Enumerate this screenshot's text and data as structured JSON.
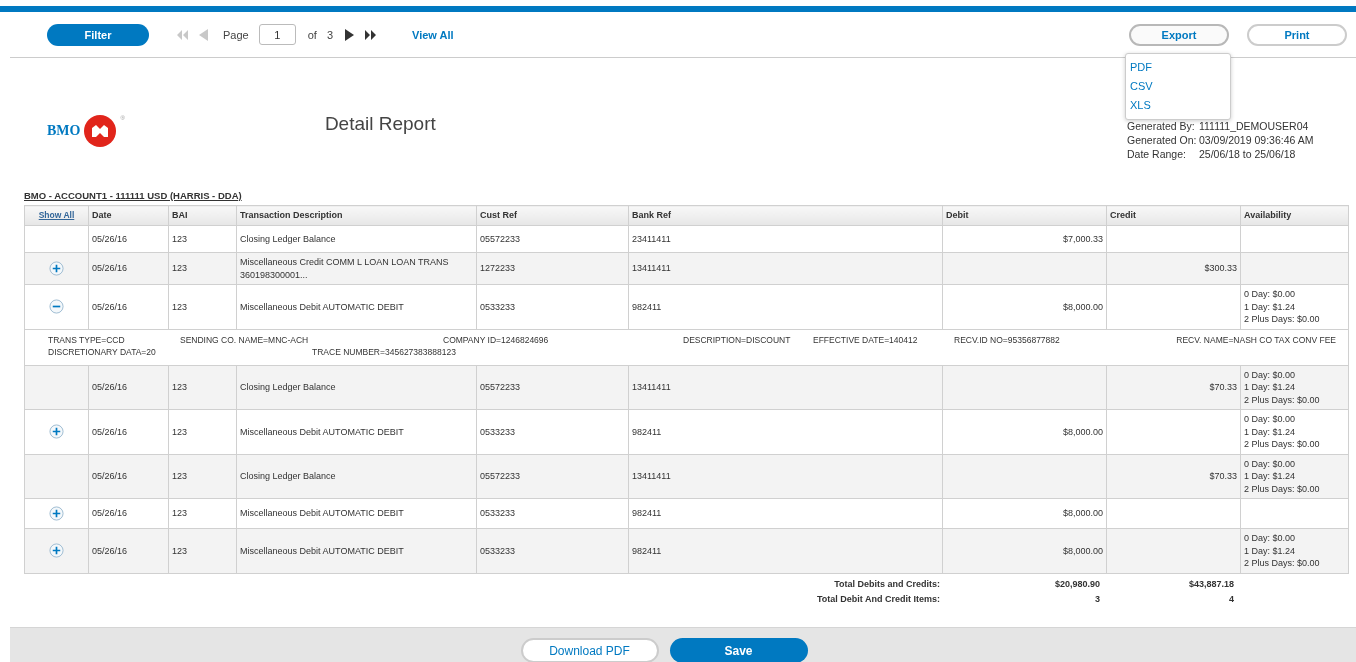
{
  "toolbar": {
    "filter": "Filter",
    "pager": {
      "first_disabled": true,
      "prev_disabled": true,
      "next_disabled": false,
      "last_disabled": false,
      "page_label": "Page",
      "page": "1",
      "of_label": "of",
      "total": "3"
    },
    "view_all": "View All",
    "export": {
      "label": "Export",
      "open": true,
      "options": [
        "PDF",
        "CSV",
        "XLS"
      ]
    },
    "print": "Print"
  },
  "header": {
    "logo_text": "BMO",
    "logo_mark": "®",
    "title": "Detail Report",
    "meta": [
      {
        "label": "Generated By:",
        "value": "111111_DEMOUSER04"
      },
      {
        "label": "Generated On:",
        "value": "03/09/2019 09:36:46 AM"
      },
      {
        "label": "Date Range:",
        "value": "25/06/18 to 25/06/18"
      }
    ]
  },
  "account": "BMO - ACCOUNT1 - 111111 USD (HARRIS - DDA)",
  "table": {
    "show_all": "Show All",
    "columns": [
      "Date",
      "BAI",
      "Transaction Description",
      "Cust Ref",
      "Bank Ref",
      "Debit",
      "Credit",
      "Availability"
    ],
    "rows": [
      {
        "date": "05/26/16",
        "bai": "123",
        "description": "Closing Ledger Balance",
        "cust_ref": "05572233",
        "bank_ref": "23411411",
        "debit": "$7,000.33",
        "credit": "",
        "availability": []
      },
      {
        "expanded": false,
        "date": "05/26/16",
        "bai": "123",
        "description": "Miscellaneous Credit COMM L LOAN LOAN TRANS 360198300001...",
        "cust_ref": "1272233",
        "bank_ref": "13411411",
        "debit": "",
        "credit": "$300.33",
        "availability": []
      },
      {
        "expanded": true,
        "date": "05/26/16",
        "bai": "123",
        "description": "Miscellaneous Debit AUTOMATIC DEBIT",
        "cust_ref": "0533233",
        "bank_ref": "982411",
        "debit": "$8,000.00",
        "credit": "",
        "availability": [
          "0 Day: $0.00",
          "1 Day: $1.24",
          "2 Plus Days: $0.00"
        ],
        "details": [
          [
            "TRANS TYPE=CCD",
            "SENDING CO. NAME=MNC-ACH",
            "COMPANY ID=1246824696",
            "DESCRIPTION=DISCOUNT",
            "EFFECTIVE DATE=140412",
            "RECV.ID NO=95356877882",
            "RECV. NAME=NASH CO TAX CONV FEE"
          ],
          [
            "DISCRETIONARY DATA=20",
            "TRACE NUMBER=345627383888123"
          ]
        ]
      },
      {
        "date": "05/26/16",
        "bai": "123",
        "description": "Closing Ledger Balance",
        "cust_ref": "05572233",
        "bank_ref": "13411411",
        "debit": "",
        "credit": "$70.33",
        "availability": [
          "0 Day: $0.00",
          "1 Day: $1.24",
          "2 Plus Days: $0.00"
        ]
      },
      {
        "expanded": false,
        "date": "05/26/16",
        "bai": "123",
        "description": "Miscellaneous Debit AUTOMATIC DEBIT",
        "cust_ref": "0533233",
        "bank_ref": "982411",
        "debit": "$8,000.00",
        "credit": "",
        "availability": [
          "0 Day: $0.00",
          "1 Day: $1.24",
          "2 Plus Days: $0.00"
        ]
      },
      {
        "date": "05/26/16",
        "bai": "123",
        "description": "Closing Ledger Balance",
        "cust_ref": "05572233",
        "bank_ref": "13411411",
        "debit": "",
        "credit": "$70.33",
        "availability": [
          "0 Day: $0.00",
          "1 Day: $1.24",
          "2 Plus Days: $0.00"
        ]
      },
      {
        "expanded": false,
        "date": "05/26/16",
        "bai": "123",
        "description": "Miscellaneous Debit AUTOMATIC DEBIT",
        "cust_ref": "0533233",
        "bank_ref": "982411",
        "debit": "$8,000.00",
        "credit": "",
        "availability": []
      },
      {
        "expanded": false,
        "date": "05/26/16",
        "bai": "123",
        "description": "Miscellaneous Debit AUTOMATIC DEBIT",
        "cust_ref": "0533233",
        "bank_ref": "982411",
        "debit": "$8,000.00",
        "credit": "",
        "availability": [
          "0 Day: $0.00",
          "1 Day: $1.24",
          "2 Plus Days: $0.00"
        ]
      }
    ],
    "totals": [
      {
        "label": "Total Debits and Credits:",
        "debit": "$20,980.90",
        "credit": "$43,887.18"
      },
      {
        "label": "Total Debit And Credit Items:",
        "debit": "3",
        "credit": "4"
      }
    ]
  },
  "footer": {
    "download": "Download PDF",
    "save": "Save"
  }
}
